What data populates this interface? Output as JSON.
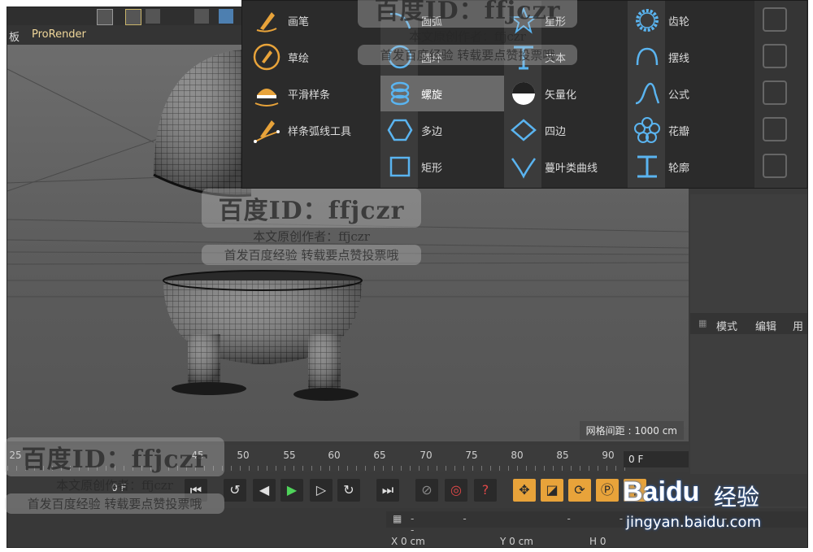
{
  "menubar": {
    "left_fragment": "板",
    "prorender": "ProRender"
  },
  "viewport": {
    "grid_readout": "网格间距 : 1000 cm"
  },
  "spline_menu": {
    "col1": [
      {
        "label": "画笔",
        "icon": "pen-icon"
      },
      {
        "label": "草绘",
        "icon": "sketch-icon"
      },
      {
        "label": "平滑样条",
        "icon": "smooth-spline-icon"
      },
      {
        "label": "样条弧线工具",
        "icon": "spline-arc-icon"
      }
    ],
    "col2": [
      {
        "label": "圆弧",
        "icon": "arc-icon"
      },
      {
        "label": "圆环",
        "icon": "circle-icon"
      },
      {
        "label": "螺旋",
        "icon": "helix-icon",
        "selected": true
      },
      {
        "label": "多边",
        "icon": "polygon-icon"
      },
      {
        "label": "矩形",
        "icon": "rectangle-icon"
      }
    ],
    "col3": [
      {
        "label": "星形",
        "icon": "star-icon"
      },
      {
        "label": "文本",
        "icon": "text-icon"
      },
      {
        "label": "矢量化",
        "icon": "vectorize-icon"
      },
      {
        "label": "四边",
        "icon": "diamond-icon"
      },
      {
        "label": "蔓叶类曲线",
        "icon": "cissoid-icon"
      }
    ],
    "col4": [
      {
        "label": "齿轮",
        "icon": "gear-icon"
      },
      {
        "label": "摆线",
        "icon": "cycloid-icon"
      },
      {
        "label": "公式",
        "icon": "formula-icon"
      },
      {
        "label": "花瓣",
        "icon": "flower-icon"
      },
      {
        "label": "轮廓",
        "icon": "profile-icon"
      }
    ]
  },
  "right_panel": {
    "tabs": [
      "模式",
      "编辑",
      "用"
    ]
  },
  "timeline": {
    "ticks": [
      "25",
      "45",
      "50",
      "55",
      "60",
      "65",
      "70",
      "75",
      "80",
      "85",
      "90"
    ],
    "current_frame": "0 F",
    "start_frame": "0 F"
  },
  "bottom": {
    "coord_head": "-- -- --",
    "coord_x": "X  0 cm",
    "coord_y": "Y  0 cm",
    "coord_h": "H  0"
  },
  "watermark": {
    "id": "百度ID：ffjczr",
    "line1": "本文原创作者：ffjczr",
    "line2": "首发百度经验  转载要点赞投票哦"
  },
  "baidu": {
    "brand": "Baidu",
    "jingyan": "经验",
    "url": "jingyan.baidu.com"
  },
  "colors": {
    "accent_orange": "#e8a33a",
    "icon_blue": "#5ab4f0",
    "selected_bg": "#6a6a6a"
  }
}
